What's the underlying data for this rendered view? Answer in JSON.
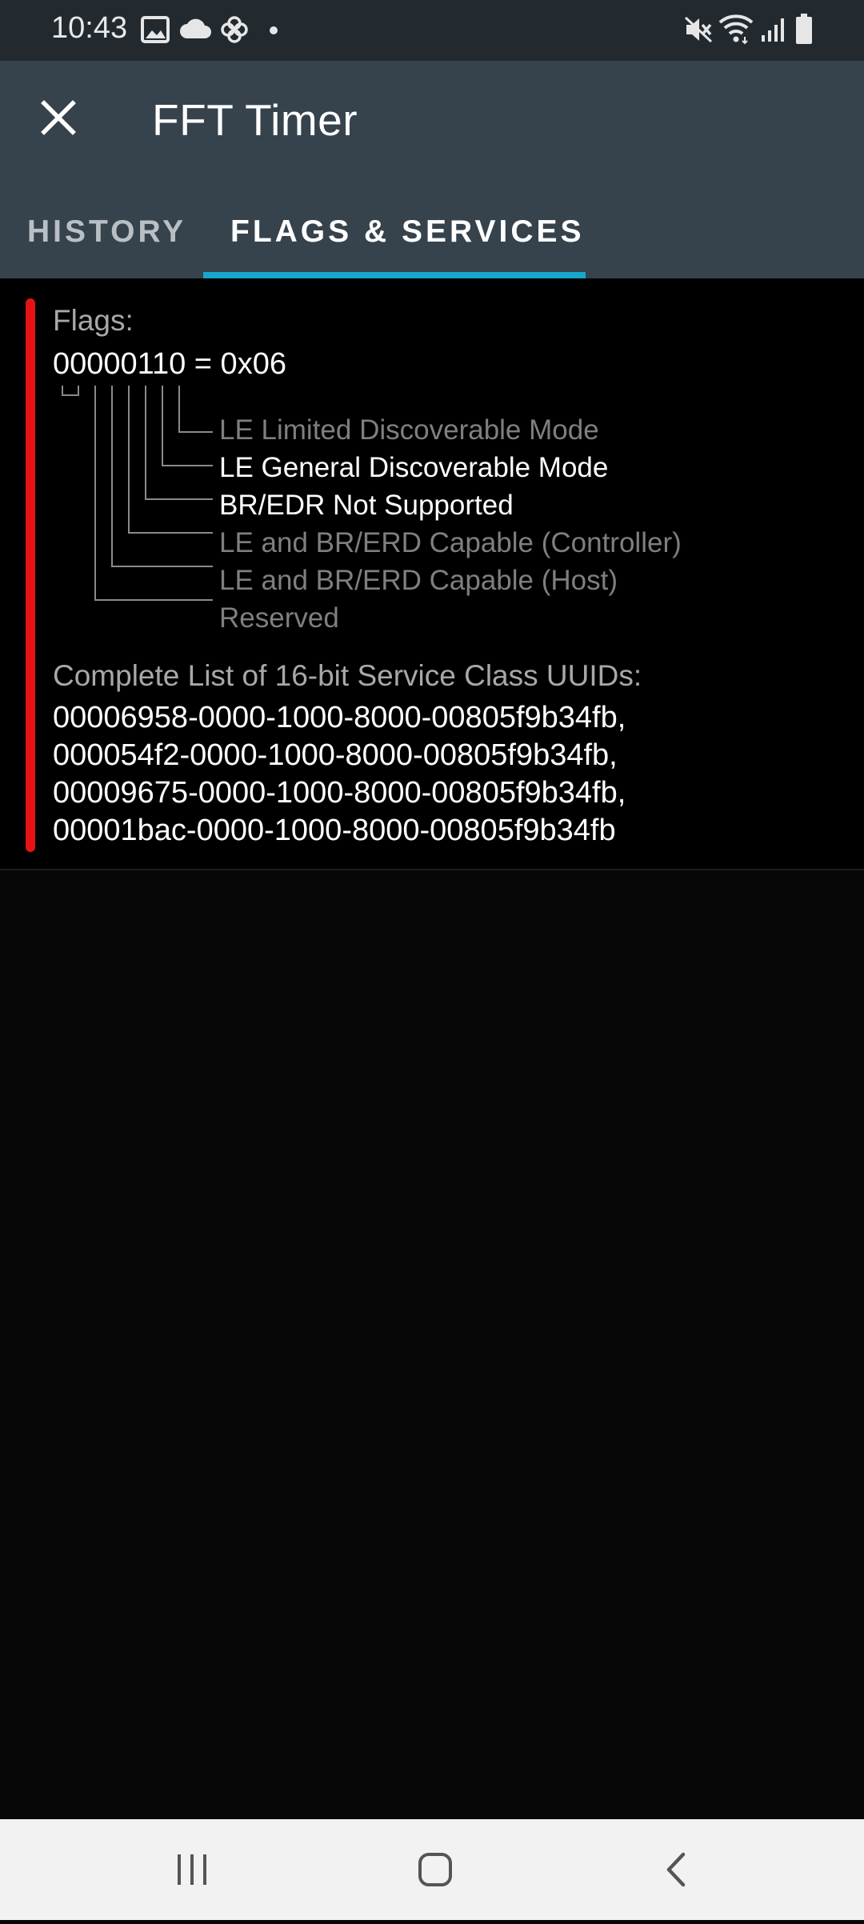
{
  "status_bar": {
    "time": "10:43",
    "icons": [
      "gallery-icon",
      "cloud-icon",
      "pinwheel-icon",
      "dot-icon",
      "mute-icon",
      "wifi-icon",
      "signal-icon",
      "battery-icon"
    ]
  },
  "app_bar": {
    "title": "FFT Timer",
    "tabs": [
      {
        "label": "HISTORY",
        "selected": false
      },
      {
        "label": "FLAGS & SERVICES",
        "selected": true
      }
    ],
    "accent_color": "#18a6cc",
    "background_color": "#36434c"
  },
  "flags": {
    "label": "Flags:",
    "value": "00000110 = 0x06",
    "bits": [
      {
        "label": "LE Limited Discoverable Mode",
        "active": false
      },
      {
        "label": "LE General Discoverable Mode",
        "active": true
      },
      {
        "label": "BR/EDR Not Supported",
        "active": true
      },
      {
        "label": "LE and BR/ERD Capable (Controller)",
        "active": false
      },
      {
        "label": "LE and BR/ERD Capable (Host)",
        "active": false
      },
      {
        "label": "Reserved",
        "active": false
      }
    ]
  },
  "services": {
    "label": "Complete List of 16-bit Service Class UUIDs:",
    "uuids": [
      "00006958-0000-1000-8000-00805f9b34fb,",
      "000054f2-0000-1000-8000-00805f9b34fb,",
      "00009675-0000-1000-8000-00805f9b34fb,",
      "00001bac-0000-1000-8000-00805f9b34fb"
    ]
  },
  "indicator_color": "#e51313",
  "nav_bar": {
    "buttons": [
      "recent-apps-icon",
      "home-icon",
      "back-icon"
    ]
  }
}
